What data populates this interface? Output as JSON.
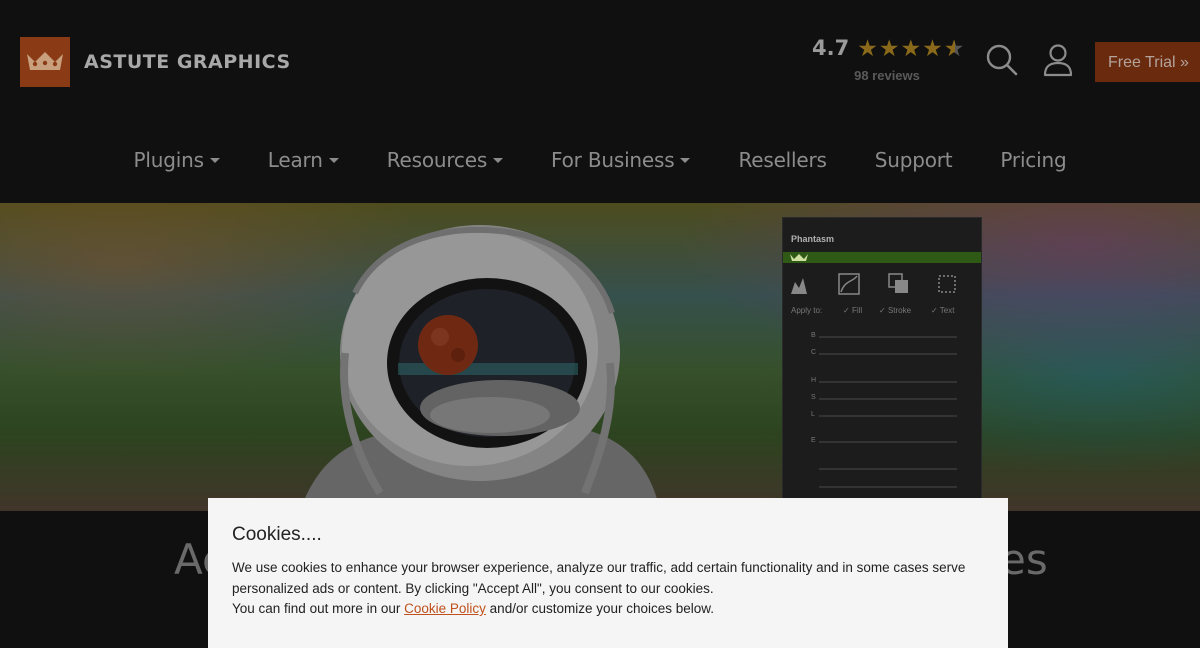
{
  "brand": {
    "name": "ASTUTE GRAPHICS",
    "accent": "#8a3a14"
  },
  "rating": {
    "score": "4.7",
    "stars": 4.7,
    "count": "98 reviews"
  },
  "header": {
    "trial_label": "Free Trial »"
  },
  "nav": {
    "items": [
      {
        "label": "Plugins",
        "dropdown": true
      },
      {
        "label": "Learn",
        "dropdown": true
      },
      {
        "label": "Resources",
        "dropdown": true
      },
      {
        "label": "For Business",
        "dropdown": true
      },
      {
        "label": "Resellers",
        "dropdown": false
      },
      {
        "label": "Support",
        "dropdown": false
      },
      {
        "label": "Pricing",
        "dropdown": false
      }
    ]
  },
  "hero": {
    "panel": {
      "title": "Phantasm",
      "apply_label": "Apply to:",
      "options": [
        "Fill",
        "Stroke",
        "Text"
      ],
      "slider_labels": [
        "B",
        "C",
        "H",
        "S",
        "L",
        "E"
      ]
    }
  },
  "main": {
    "title_start": "Ac",
    "title_end": "es"
  },
  "cookie": {
    "title": "Cookies....",
    "text_1": "We use cookies to enhance your browser experience, analyze our traffic, add certain functionality and in some cases serve personalized ads or content. By clicking \"Accept All\", you consent to our cookies.",
    "text_2_before": "You can find out more in our ",
    "link": "Cookie Policy",
    "text_2_after": " and/or customize your choices below."
  }
}
